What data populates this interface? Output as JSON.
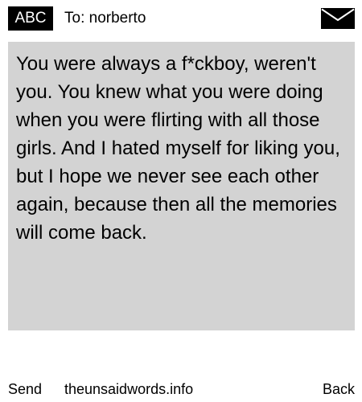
{
  "header": {
    "input_mode": "ABC",
    "recipient": "To: norberto",
    "envelope_icon": "envelope-icon"
  },
  "message": {
    "body": "You were always a f*ckboy, weren't you. You knew what you were doing when you were flirting with all those girls. And I hated myself for liking you, but I hope we never see each other again, because then all the memories will come back."
  },
  "footer": {
    "send_label": "Send",
    "site": "theunsaidwords.info",
    "back_label": "Back"
  },
  "colors": {
    "message_background": "#d3d3d3",
    "badge_background": "#000000",
    "page_background": "#ffffff"
  }
}
